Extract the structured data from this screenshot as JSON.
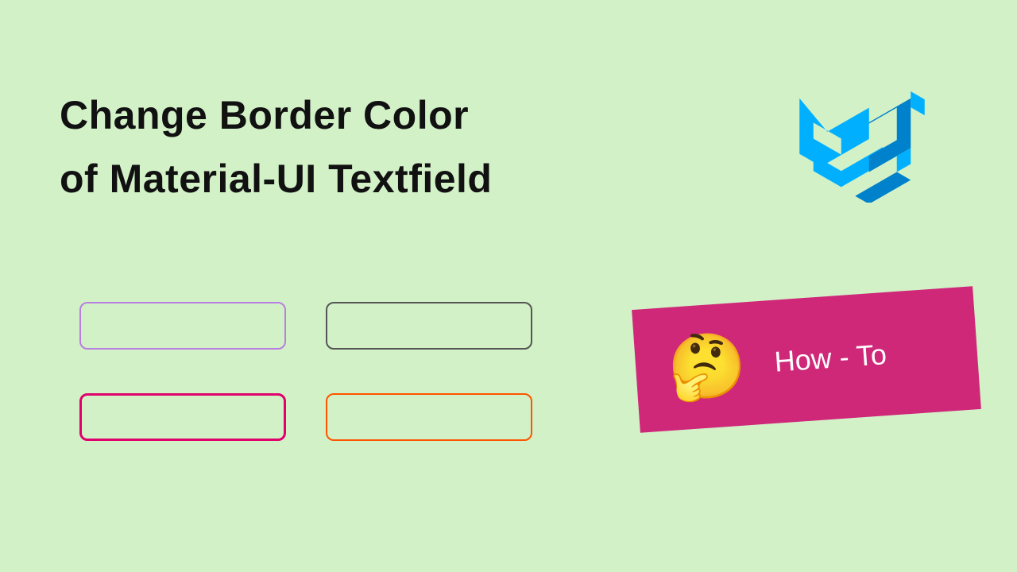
{
  "title": {
    "line1": "Change Border Color",
    "line2": "of Material-UI Textfield"
  },
  "logo": {
    "name": "material-ui"
  },
  "textfields": [
    {
      "borderColor": "#b87fe0",
      "borderWidth": 2
    },
    {
      "borderColor": "#555555",
      "borderWidth": 2
    },
    {
      "borderColor": "#e0006c",
      "borderWidth": 3
    },
    {
      "borderColor": "#ff5400",
      "borderWidth": 2
    }
  ],
  "howto": {
    "emoji": "🤔",
    "label": "How - To",
    "background": "#cf2879"
  }
}
